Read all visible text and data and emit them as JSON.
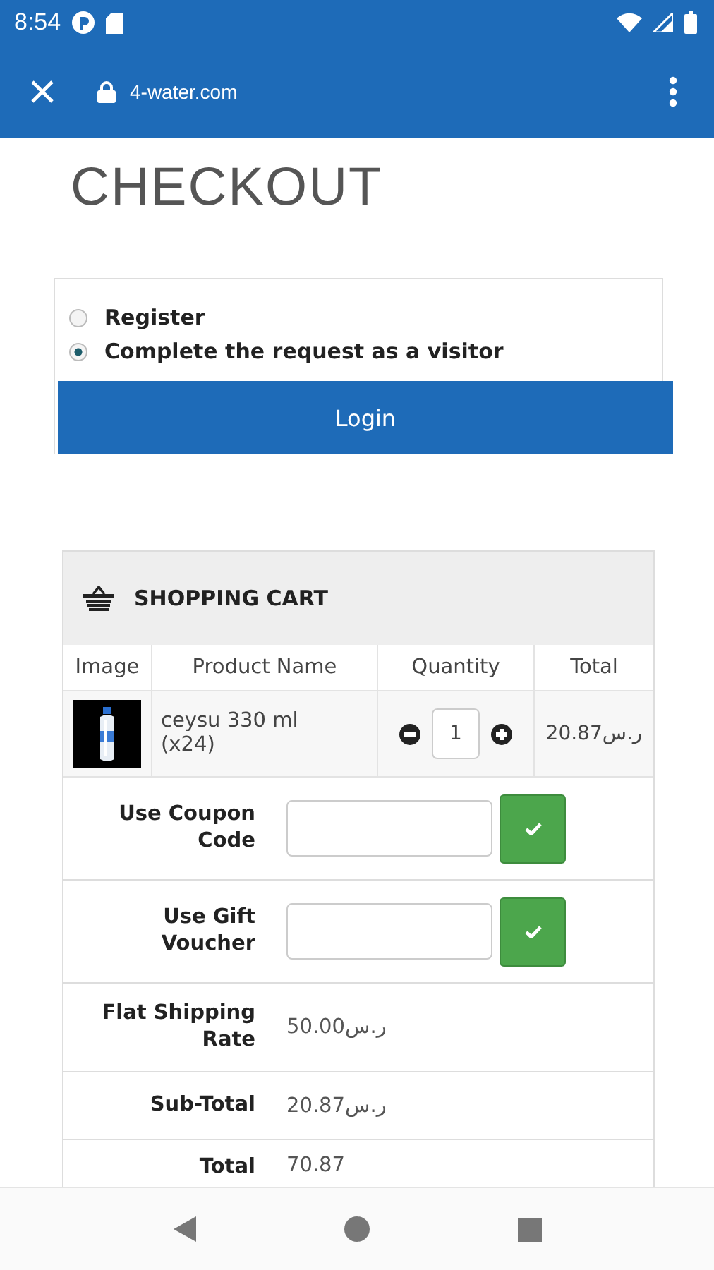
{
  "status_bar": {
    "time": "8:54"
  },
  "browser": {
    "url": "4-water.com"
  },
  "page": {
    "title": "CHECKOUT",
    "options": [
      {
        "label": "Register",
        "selected": false
      },
      {
        "label": "Complete the request as a visitor",
        "selected": true
      }
    ],
    "login_button": "Login"
  },
  "cart": {
    "title": "SHOPPING CART",
    "columns": [
      "Image",
      "Product Name",
      "Quantity",
      "Total"
    ],
    "rows": [
      {
        "name": "ceysu 330 ml (x24)",
        "quantity": "1",
        "total": "20.87ر.س"
      }
    ],
    "summary": [
      {
        "kind": "input",
        "label": "Use Coupon Code"
      },
      {
        "kind": "input",
        "label": "Use Gift Voucher"
      },
      {
        "kind": "value",
        "label": "Flat Shipping Rate",
        "value": "50.00ر.س"
      },
      {
        "kind": "value",
        "label": "Sub-Total",
        "value": "20.87ر.س"
      },
      {
        "kind": "value",
        "label": "Total",
        "value": "70.87"
      }
    ]
  }
}
